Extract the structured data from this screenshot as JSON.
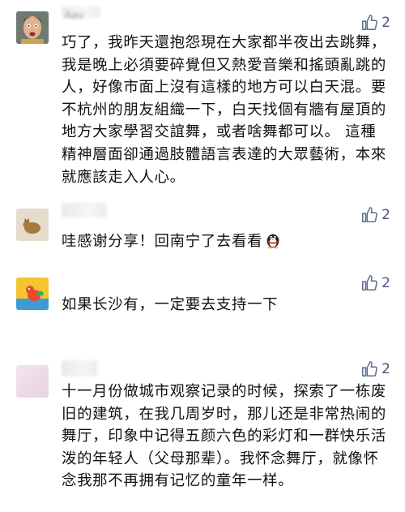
{
  "comments": [
    {
      "username_visible": "Aau",
      "likes": "2",
      "text": "巧了，我昨天還抱怨現在大家都半夜出去跳舞，我是晚上必須要碎覺但又熱愛音樂和搖頭亂跳的人，好像市面上沒有這樣的地方可以白天混。要不杭州的朋友組織一下，白天找個有牆有屋頂的地方大家學習交誼舞，或者啥舞都可以。 這種精神層面卻通過肢體語言表達的大眾藝術，本來就應該走入人心。"
    },
    {
      "likes": "2",
      "text": "哇感谢分享！回南宁了去看看",
      "emoji": "penguin-icon"
    },
    {
      "likes": "2",
      "text": "如果长沙有，一定要去支持一下"
    },
    {
      "likes": "2",
      "text": "十一月份做城市观察记录的时候，探索了一栋废旧的建筑，在我几周岁时，那儿还是非常热闹的舞厅，印象中记得五颜六色的彩灯和一群快乐活泼的年轻人（父母那辈）。我怀念舞厅，就像怀念我那不再拥有记忆的童年一样。"
    }
  ],
  "colors": {
    "like_icon": "#5a6a8f",
    "text": "#111111"
  }
}
